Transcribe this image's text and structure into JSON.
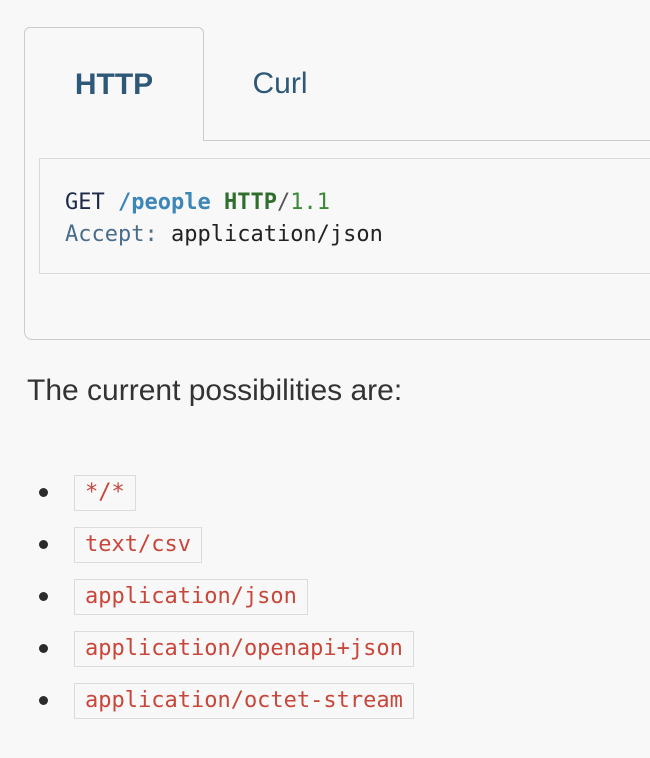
{
  "tabs": {
    "active_label": "HTTP",
    "inactive_label": "Curl"
  },
  "code": {
    "method": "GET",
    "path": "/people",
    "protocol": "HTTP",
    "slash": "/",
    "version": "1.1",
    "header_name": "Accept",
    "header_sep": ":",
    "header_value": "application/json"
  },
  "intro_text": "The current possibilities are:",
  "possibilities": [
    "*/*",
    "text/csv",
    "application/json",
    "application/openapi+json",
    "application/octet-stream"
  ],
  "colors": {
    "tab_text": "#2e5878",
    "inline_code": "#c9463a",
    "path": "#3d86b8",
    "protocol": "#2f6e2d"
  }
}
